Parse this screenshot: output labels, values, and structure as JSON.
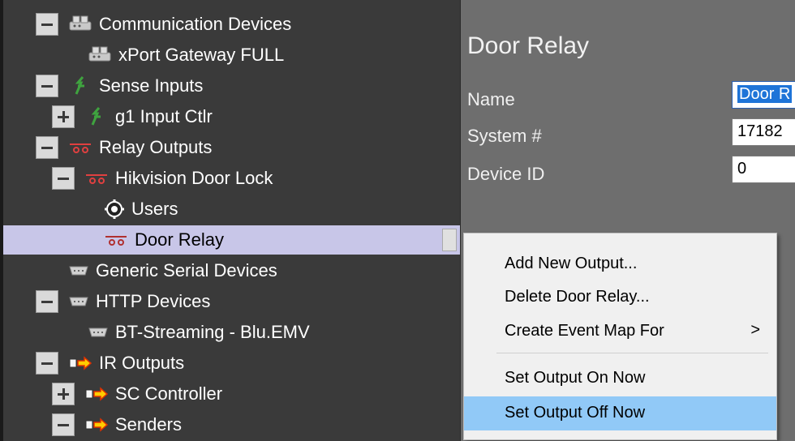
{
  "tree": {
    "items": [
      {
        "label": "Communication Devices",
        "icon": "network-device-icon",
        "expander": "minus"
      },
      {
        "label": "xPort Gateway FULL",
        "icon": "network-device-icon",
        "expander": "none"
      },
      {
        "label": "Sense Inputs",
        "icon": "sense-input-icon",
        "expander": "minus"
      },
      {
        "label": "g1 Input Ctlr",
        "icon": "sense-input-icon",
        "expander": "plus"
      },
      {
        "label": "Relay Outputs",
        "icon": "relay-icon",
        "expander": "minus"
      },
      {
        "label": "Hikvision Door Lock",
        "icon": "relay-icon",
        "expander": "minus"
      },
      {
        "label": "Users",
        "icon": "gear-icon",
        "expander": "none"
      },
      {
        "label": "Door Relay",
        "icon": "relay-icon",
        "expander": "none",
        "selected": true
      },
      {
        "label": "Generic Serial Devices",
        "icon": "serial-port-icon",
        "expander": "none"
      },
      {
        "label": "HTTP Devices",
        "icon": "serial-port-icon",
        "expander": "minus"
      },
      {
        "label": "BT-Streaming - Blu.EMV",
        "icon": "serial-port-icon",
        "expander": "none"
      },
      {
        "label": "IR Outputs",
        "icon": "ir-output-icon",
        "expander": "minus"
      },
      {
        "label": "SC Controller",
        "icon": "ir-output-icon",
        "expander": "plus"
      },
      {
        "label": "Senders",
        "icon": "ir-output-icon",
        "expander": "minus"
      }
    ]
  },
  "details": {
    "title": "Door Relay",
    "name_label": "Name",
    "name_value": "Door R",
    "system_label": "System #",
    "system_value": "17182",
    "device_id_label": "Device ID",
    "device_id_value": "0"
  },
  "context_menu": {
    "items": [
      {
        "label": "Add New Output..."
      },
      {
        "label": "Delete Door Relay..."
      },
      {
        "label": "Create Event Map For",
        "submenu_arrow": ">"
      },
      {
        "label": "Set Output On Now"
      },
      {
        "label": "Set Output Off Now",
        "hover": true
      }
    ]
  },
  "colors": {
    "tree_bg": "#3a3a3a",
    "panel_bg": "#6e6e6e",
    "selection_bg": "#c8c6e8",
    "menu_hover": "#91c9f7",
    "text_highlight": "#1e74d8"
  }
}
